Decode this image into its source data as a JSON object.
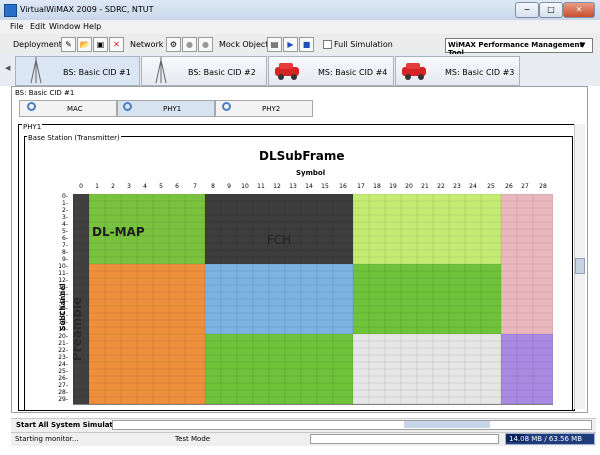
{
  "window": {
    "title": "VirtualWiMAX 2009 - SDRC, NTUT",
    "min_label": "−",
    "max_label": "□",
    "close_label": "✕"
  },
  "menu": {
    "items": [
      "File",
      "Edit",
      "Window",
      "Help"
    ]
  },
  "toolbar": {
    "deployment": "Deployment",
    "network": "Network",
    "mock_object": "Mock Object",
    "full_simulation": "Full Simulation",
    "perf_tool": "WiMAX Performance Management Tool",
    "icons": [
      "deploy-new-icon",
      "open-folder-icon",
      "save-icon",
      "delete-icon",
      "network-settings-icon",
      "network-disabled-icon",
      "network-stop-icon",
      "mock-open-icon",
      "play-icon",
      "stop-icon"
    ]
  },
  "tabs": [
    {
      "label": "BS: Basic CID #1",
      "icon": "antenna-tower-icon"
    },
    {
      "label": "BS: Basic CID #2",
      "icon": "antenna-tower-icon"
    },
    {
      "label": "MS: Basic CID #4",
      "icon": "red-car-icon"
    },
    {
      "label": "MS: Basic CID #3",
      "icon": "red-car-icon"
    }
  ],
  "panel": {
    "title": "BS: Basic CID #1",
    "subtabs": [
      "MAC",
      "PHY1",
      "PHY2"
    ],
    "phy_title": "PHY1",
    "frame_title": "Base Station (Transmitter)"
  },
  "chart_data": {
    "type": "heatmap",
    "title": "DLSubFrame",
    "xlabel": "Symbol",
    "ylabel": "SubChannel",
    "x": [
      0,
      1,
      2,
      3,
      4,
      5,
      6,
      7,
      8,
      9,
      10,
      11,
      12,
      13,
      14,
      15,
      16,
      17,
      18,
      19,
      20,
      21,
      22,
      23,
      24,
      25,
      26,
      27,
      28
    ],
    "y": [
      0,
      1,
      2,
      3,
      4,
      5,
      6,
      7,
      8,
      9,
      10,
      11,
      12,
      13,
      14,
      15,
      16,
      17,
      18,
      19,
      20,
      21,
      22,
      23,
      24,
      25,
      26,
      27,
      28,
      29
    ],
    "regions": [
      {
        "label": "Preamble",
        "x": [
          0,
          0
        ],
        "y": [
          0,
          29
        ],
        "color": "#404040"
      },
      {
        "label": "DL-MAP",
        "x": [
          1,
          7
        ],
        "y": [
          0,
          9
        ],
        "color": "#78c23e"
      },
      {
        "label": "",
        "x": [
          1,
          7
        ],
        "y": [
          10,
          29
        ],
        "color": "#ee8f3c"
      },
      {
        "label": "FCH",
        "x": [
          8,
          16
        ],
        "y": [
          0,
          9
        ],
        "color": "#3d3d3d"
      },
      {
        "label": "",
        "x": [
          17,
          25
        ],
        "y": [
          0,
          9
        ],
        "color": "#c6eb74"
      },
      {
        "label": "",
        "x": [
          26,
          28
        ],
        "y": [
          0,
          19
        ],
        "color": "#e9b7be"
      },
      {
        "label": "",
        "x": [
          8,
          16
        ],
        "y": [
          10,
          19
        ],
        "color": "#7cb3e1"
      },
      {
        "label": "",
        "x": [
          17,
          25
        ],
        "y": [
          10,
          19
        ],
        "color": "#6fc33a"
      },
      {
        "label": "",
        "x": [
          8,
          16
        ],
        "y": [
          20,
          29
        ],
        "color": "#6fc33a"
      },
      {
        "label": "",
        "x": [
          17,
          25
        ],
        "y": [
          20,
          29
        ],
        "color": "#e6e6e6"
      },
      {
        "label": "",
        "x": [
          26,
          28
        ],
        "y": [
          20,
          29
        ],
        "color": "#a98ae1"
      }
    ]
  },
  "status": {
    "start_all": "Start All System Simulation",
    "top_progress": 0.18,
    "starting": "Starting monitor...",
    "test_mode": "Test Mode",
    "memory": "14.08 MB / 63.56 MB",
    "memory_fraction": 0.22
  }
}
